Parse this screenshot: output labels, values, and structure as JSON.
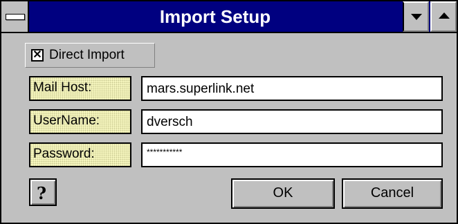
{
  "window": {
    "title": "Import Setup"
  },
  "direct_import": {
    "label": "Direct Import",
    "checked": true
  },
  "fields": [
    {
      "label": "Mail Host:",
      "value": "mars.superlink.net"
    },
    {
      "label": "UserName:",
      "value": "dversch"
    },
    {
      "label": "Password:",
      "value": "***********"
    }
  ],
  "buttons": {
    "help": "?",
    "ok": "OK",
    "cancel": "Cancel"
  },
  "icons": {
    "system_menu": "system-menu-icon",
    "minimize": "chevron-down-icon",
    "maximize": "chevron-up-icon"
  },
  "colors": {
    "title_bar": "#000080",
    "face": "#c0c0c0",
    "label_bg": "#ffffc8"
  }
}
